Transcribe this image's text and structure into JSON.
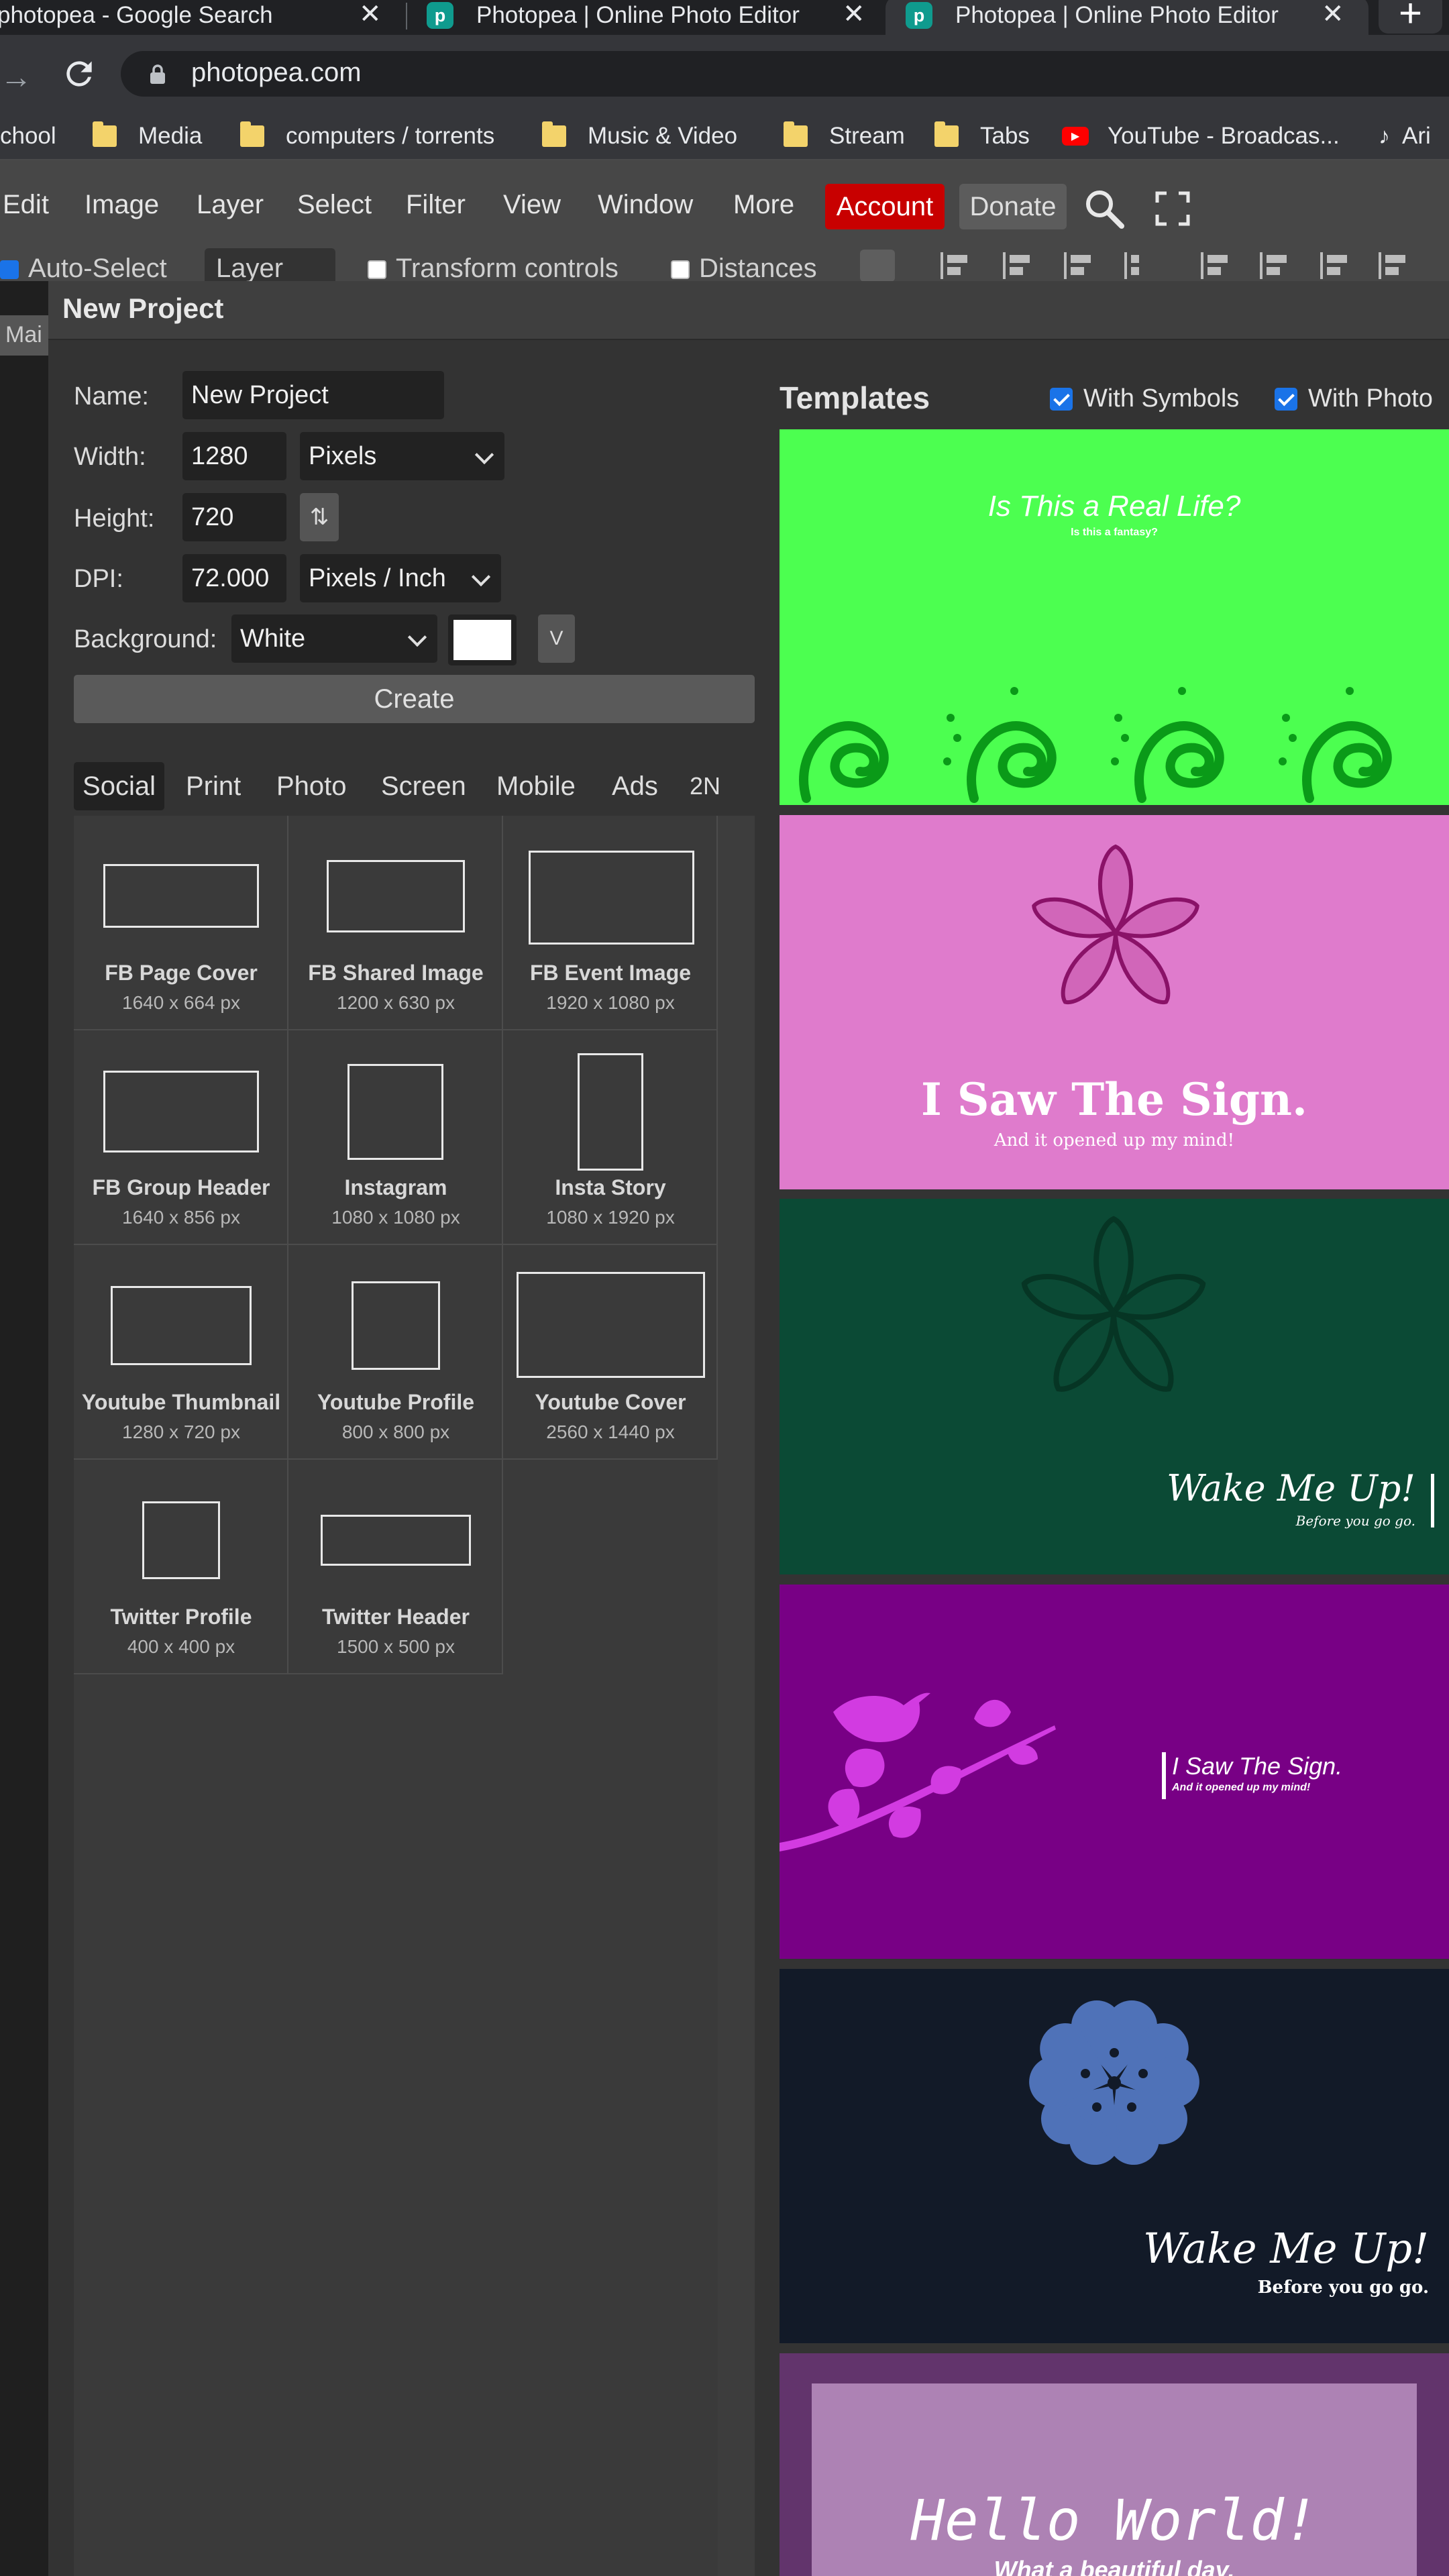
{
  "browser": {
    "tabs": [
      {
        "title": "photopea - Google Search"
      },
      {
        "title": "Photopea | Online Photo Editor"
      },
      {
        "title": "Photopea | Online Photo Editor"
      }
    ],
    "new_tab": "+",
    "url": "photopea.com",
    "bookmarks": [
      {
        "label": "chool"
      },
      {
        "label": "Media"
      },
      {
        "label": "computers / torrents"
      },
      {
        "label": "Music & Video"
      },
      {
        "label": "Stream"
      },
      {
        "label": "Tabs"
      },
      {
        "label": "YouTube - Broadcas..."
      },
      {
        "label": "Ari"
      }
    ]
  },
  "menu": {
    "items": [
      "Edit",
      "Image",
      "Layer",
      "Select",
      "Filter",
      "View",
      "Window",
      "More"
    ],
    "account": "Account",
    "donate": "Donate"
  },
  "options": {
    "auto_select": "Auto-Select",
    "layer": "Layer",
    "transform_controls": "Transform controls",
    "distances": "Distances"
  },
  "left_tab": "Mai",
  "dialog": {
    "title": "New Project",
    "name_label": "Name:",
    "name_value": "New Project",
    "width_label": "Width:",
    "width_value": "1280",
    "width_unit": "Pixels",
    "height_label": "Height:",
    "height_value": "720",
    "dpi_label": "DPI:",
    "dpi_value": "72.000",
    "dpi_unit": "Pixels / Inch",
    "background_label": "Background:",
    "background_value": "White",
    "background_color": "#ffffff",
    "v_button": "V",
    "create": "Create",
    "categories": [
      "Social",
      "Print",
      "Photo",
      "Screen",
      "Mobile",
      "Ads",
      "2N"
    ],
    "presets": [
      {
        "name": "FB Page Cover",
        "size": "1640 x 664 px"
      },
      {
        "name": "FB Shared Image",
        "size": "1200 x 630 px"
      },
      {
        "name": "FB Event Image",
        "size": "1920 x 1080 px"
      },
      {
        "name": "FB Group Header",
        "size": "1640 x 856 px"
      },
      {
        "name": "Instagram",
        "size": "1080 x 1080 px"
      },
      {
        "name": "Insta Story",
        "size": "1080 x 1920 px"
      },
      {
        "name": "Youtube Thumbnail",
        "size": "1280 x 720 px"
      },
      {
        "name": "Youtube Profile",
        "size": "800 x 800 px"
      },
      {
        "name": "Youtube Cover",
        "size": "2560 x 1440 px"
      },
      {
        "name": "Twitter Profile",
        "size": "400 x 400 px"
      },
      {
        "name": "Twitter Header",
        "size": "1500 x 500 px"
      }
    ],
    "templates": {
      "title": "Templates",
      "with_symbols": "With Symbols",
      "with_photo": "With Photo",
      "items": [
        {
          "headline": "Is This a Real Life?",
          "sub": "Is this a fantasy?",
          "bg": "#4cff50"
        },
        {
          "headline": "I Saw The Sign.",
          "sub": "And it opened up my mind!",
          "bg": "#df7bcc"
        },
        {
          "headline": "Wake Me Up!",
          "sub": "Before you go go.",
          "bg": "#0b4a35"
        },
        {
          "headline": "I Saw The Sign.",
          "sub": "And it opened up my mind!",
          "bg": "#780085"
        },
        {
          "headline": "Wake Me Up!",
          "sub": "Before you go go.",
          "bg": "#121a28"
        },
        {
          "headline": "Hello World!",
          "sub": "What a beautiful day.",
          "bg": "#62346c"
        }
      ]
    }
  }
}
